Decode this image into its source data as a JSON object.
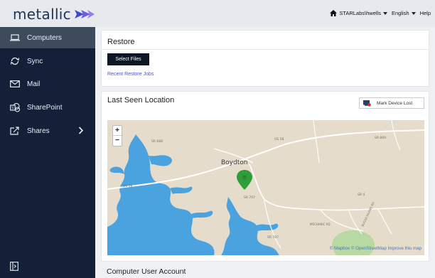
{
  "header": {
    "logo_text": "metallic",
    "user_label": "STARLabs\\hwells",
    "language_label": "English",
    "help_label": "Help"
  },
  "sidebar": {
    "items": [
      {
        "label": "Computers",
        "icon": "laptop-icon",
        "active": true
      },
      {
        "label": "Sync",
        "icon": "sync-icon"
      },
      {
        "label": "Mail",
        "icon": "mail-icon"
      },
      {
        "label": "SharePoint",
        "icon": "sharepoint-icon"
      },
      {
        "label": "Shares",
        "icon": "shares-icon"
      }
    ]
  },
  "restore": {
    "title": "Restore",
    "select_files_label": "Select Files",
    "recent_jobs_label": "Recent Restore Jobs"
  },
  "location": {
    "title": "Last Seen Location",
    "mark_lost_label": "Mark Device Lost",
    "map": {
      "town_label": "Boydton",
      "zoom_in": "+",
      "zoom_out": "−",
      "road_labels": [
        "SR 688",
        "US 58",
        "SR 869",
        "US 58",
        "SR 707",
        "SR 4",
        "SR 707",
        "BUGGS ISLAND RD",
        "MECHANIC RD"
      ],
      "attribution": "© Mapbox © OpenStreetMap Improve this map",
      "colors": {
        "land": "#e6dccb",
        "water": "#4aa3df",
        "park": "#b9d9a2",
        "marker": "#2e9d3a",
        "road": "#ffffff"
      }
    }
  },
  "account": {
    "title": "Computer User Account"
  },
  "colors": {
    "sidebar_bg": "#142038",
    "sidebar_active": "#3e4b5d",
    "topbar_bg": "#e7e9ee",
    "brand": "#1e3558",
    "link": "#4b56c2"
  }
}
